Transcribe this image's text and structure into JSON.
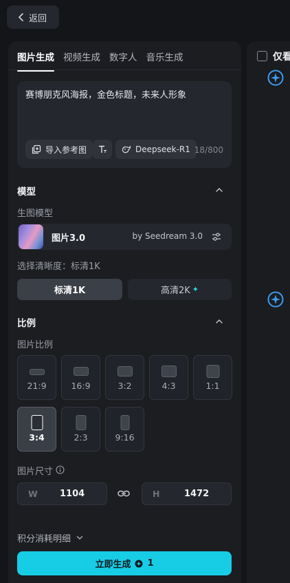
{
  "back": {
    "label": "返回"
  },
  "tabs": [
    {
      "label": "图片生成",
      "active": true
    },
    {
      "label": "视频生成",
      "active": false
    },
    {
      "label": "数字人",
      "active": false
    },
    {
      "label": "音乐生成",
      "active": false
    }
  ],
  "prompt": {
    "text": "赛博朋克风海报，金色标题，未来人形象",
    "counter": "18/800",
    "chips": {
      "import_ref": "导入参考图",
      "deepseek": "Deepseek-R1"
    }
  },
  "model_section": {
    "title": "模型",
    "sub_label": "生图模型",
    "model_name": "图片3.0",
    "model_by": "by Seedream 3.0",
    "resolution_label": "选择清晰度：标清1K",
    "resolution_std": "标清1K",
    "resolution_hd": "高清2K",
    "resolution_selected": "标清1K"
  },
  "ratio_section": {
    "title": "比例",
    "sub_label": "图片比例",
    "ratios": [
      "21:9",
      "16:9",
      "3:2",
      "4:3",
      "1:1",
      "3:4",
      "2:3",
      "9:16"
    ],
    "selected": "3:4",
    "size_label": "图片尺寸",
    "width_prefix": "W",
    "width_value": "1104",
    "height_prefix": "H",
    "height_value": "1472"
  },
  "credits": {
    "label": "积分消耗明细"
  },
  "generate": {
    "label": "立即生成",
    "cost": "1"
  },
  "right_panel": {
    "only_view_label": "仅看"
  },
  "colors": {
    "accent": "#17cde6",
    "background": "#141518",
    "panel": "#1b1d21"
  },
  "icons": [
    "chevron-left-icon",
    "image-upload-icon",
    "text-style-icon",
    "deepseek-whale-icon",
    "chevron-up-icon",
    "settings-sliders-icon",
    "sparkle-icon",
    "info-icon",
    "link-icon",
    "chevron-down-icon",
    "coin-icon"
  ]
}
